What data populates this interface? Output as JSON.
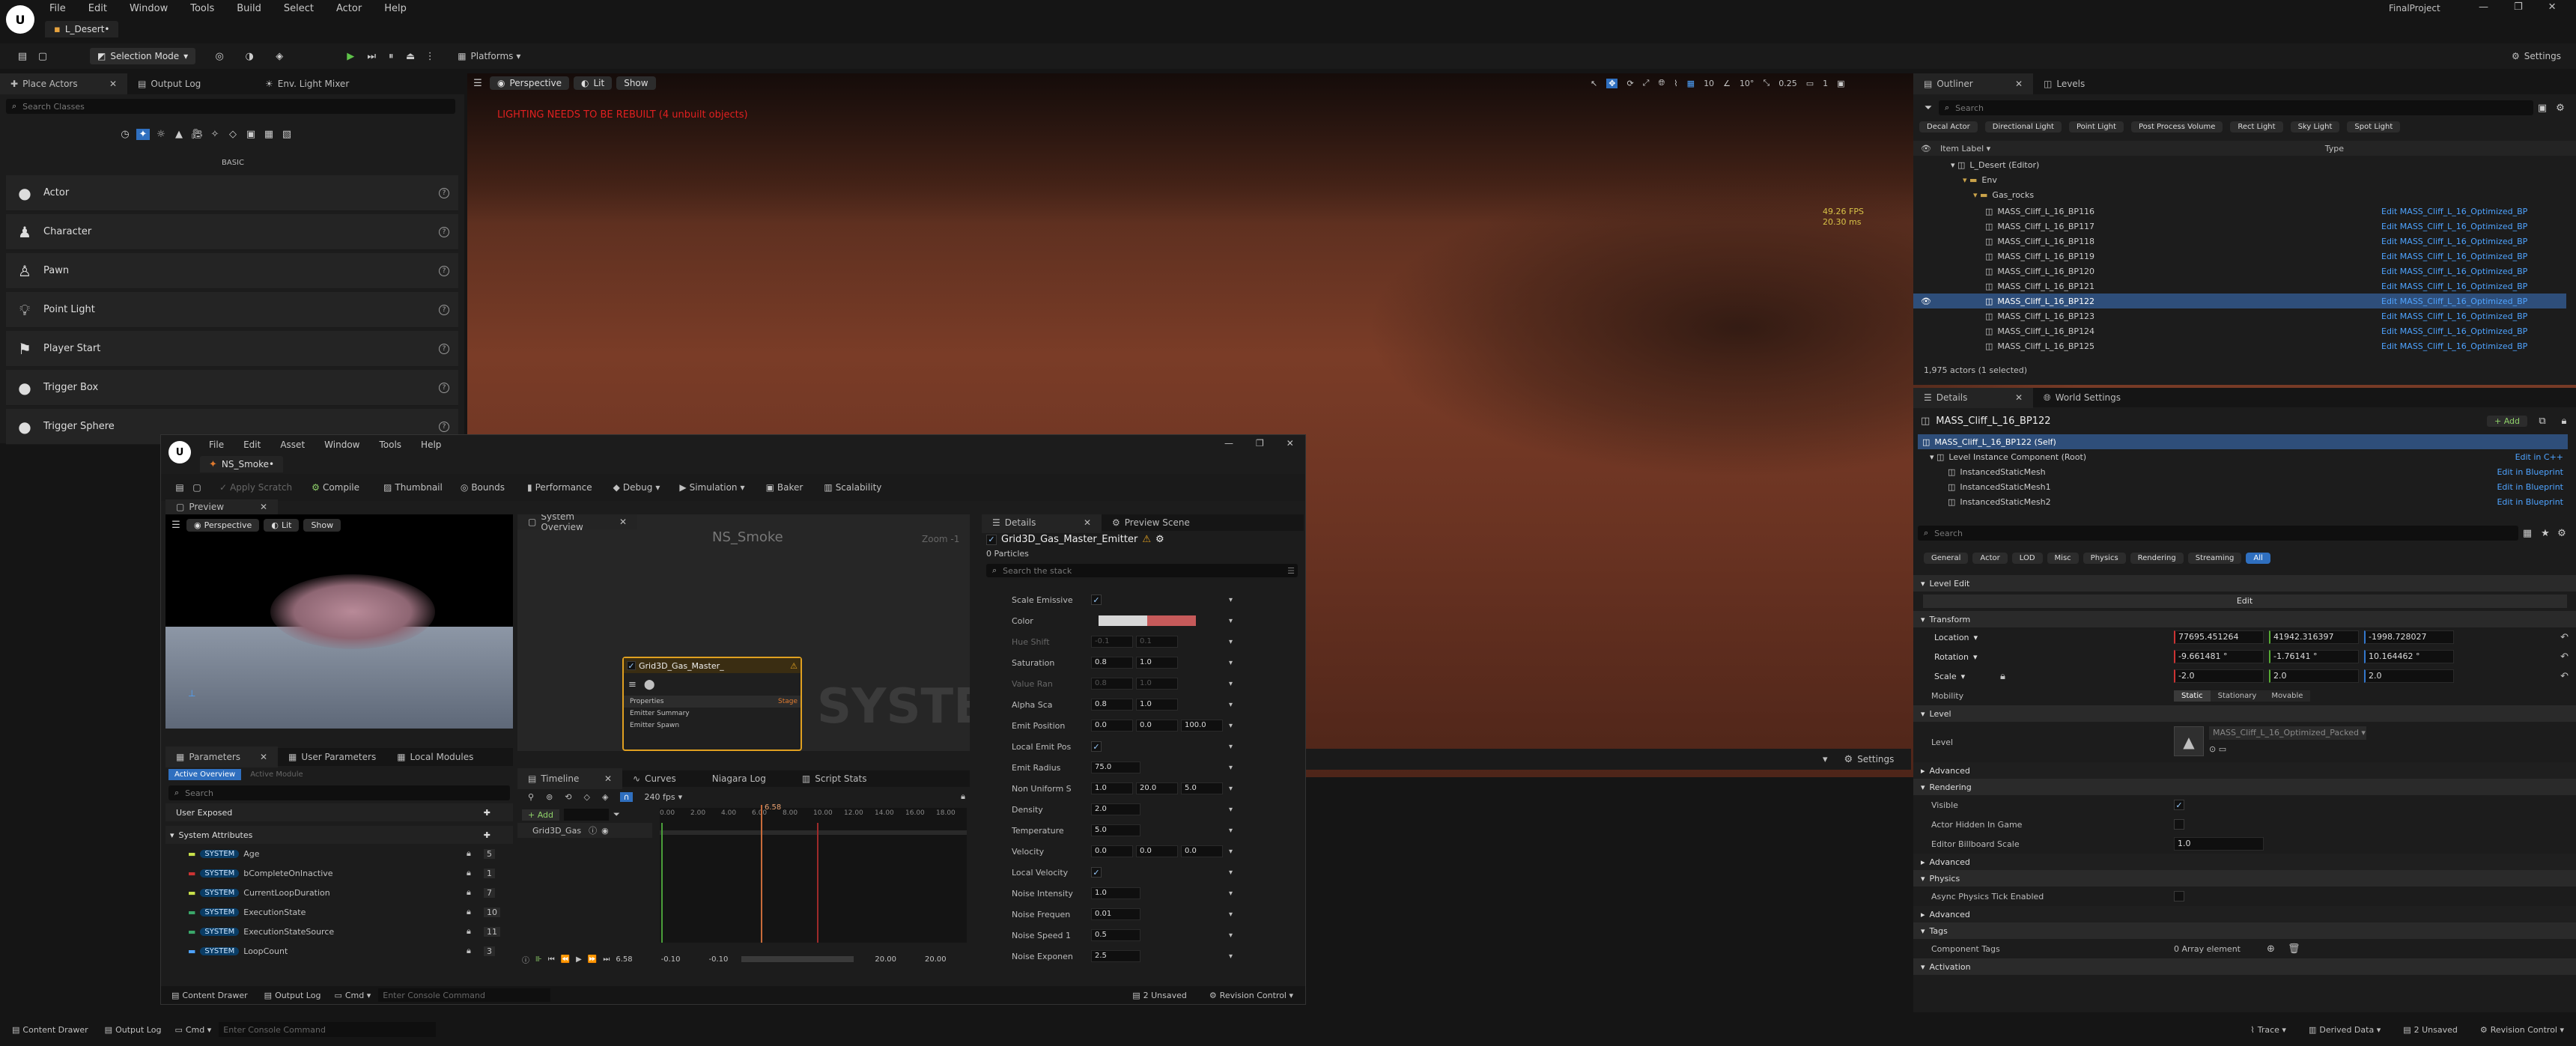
{
  "app": {
    "logo": "U",
    "menu": [
      "File",
      "Edit",
      "Window",
      "Tools",
      "Build",
      "Select",
      "Actor",
      "Help"
    ],
    "level_tab": "L_Desert•",
    "project": "FinalProject",
    "win_controls": [
      "—",
      "❐",
      "✕"
    ]
  },
  "toolbar": {
    "mode": "Selection Mode",
    "platforms": "Platforms",
    "settings": "Settings"
  },
  "left_tabs": [
    "Place Actors",
    "Output Log",
    "Env. Light Mixer"
  ],
  "place": {
    "search_placeholder": "Search Classes",
    "category": "BASIC",
    "items": [
      "Actor",
      "Character",
      "Pawn",
      "Point Light",
      "Player Start",
      "Trigger Box",
      "Trigger Sphere"
    ]
  },
  "viewport": {
    "perspective": "Perspective",
    "lit": "Lit",
    "show": "Show",
    "warning": "LIGHTING NEEDS TO BE REBUILT (4 unbuilt objects)",
    "fps": "49.26 FPS",
    "ms": "20.30 ms",
    "snap_vals": [
      "10",
      "10°",
      "0.25",
      "1"
    ],
    "settings": "Settings"
  },
  "outliner": {
    "tabs": [
      "Outliner",
      "Levels"
    ],
    "search_placeholder": "Search",
    "filters": [
      "Decal Actor",
      "Directional Light",
      "Point Light",
      "Post Process Volume",
      "Rect Light",
      "Sky Light",
      "Spot Light"
    ],
    "col_label": "Item Label ▾",
    "col_type": "Type",
    "tree": [
      "L_Desert (Editor)",
      "Env",
      "Gas_rocks"
    ],
    "rows": [
      "MASS_Cliff_L_16_BP116",
      "MASS_Cliff_L_16_BP117",
      "MASS_Cliff_L_16_BP118",
      "MASS_Cliff_L_16_BP119",
      "MASS_Cliff_L_16_BP120",
      "MASS_Cliff_L_16_BP121",
      "MASS_Cliff_L_16_BP122",
      "MASS_Cliff_L_16_BP123",
      "MASS_Cliff_L_16_BP124",
      "MASS_Cliff_L_16_BP125"
    ],
    "row_type": "Edit MASS_Cliff_L_16_Optimized_BP",
    "status": "1,975 actors (1 selected)"
  },
  "details": {
    "tabs": [
      "Details",
      "World Settings"
    ],
    "actor": "MASS_Cliff_L_16_BP122",
    "add": "+ Add",
    "self": "MASS_Cliff_L_16_BP122 (Self)",
    "root": "Level Instance Component (Root)",
    "root_link": "Edit in C++",
    "comps": [
      "InstancedStaticMesh",
      "InstancedStaticMesh1",
      "InstancedStaticMesh2"
    ],
    "comp_link": "Edit in Blueprint",
    "search_placeholder": "Search",
    "filters": [
      "General",
      "Actor",
      "LOD",
      "Misc",
      "Physics",
      "Rendering",
      "Streaming",
      "All"
    ],
    "sec_level_edit": "Level Edit",
    "edit_btn": "Edit",
    "sec_transform": "Transform",
    "location": "Location",
    "loc": [
      "77695.451264",
      "41942.316397",
      "-1998.728027"
    ],
    "rotation": "Rotation",
    "rot": [
      "-9.661481 °",
      "-1.76141 °",
      "10.164462 °"
    ],
    "scale": "Scale",
    "scl": [
      "-2.0",
      "2.0",
      "2.0"
    ],
    "mobility": "Mobility",
    "mob": [
      "Static",
      "Stationary",
      "Movable"
    ],
    "sec_level": "Level",
    "level_label": "Level",
    "level_val": "MASS_Cliff_L_16_Optimized_Packed ▾",
    "advanced": "Advanced",
    "sec_rendering": "Rendering",
    "visible": "Visible",
    "hidden": "Actor Hidden In Game",
    "billboard": "Editor Billboard Scale",
    "billboard_val": "1.0",
    "sec_physics": "Physics",
    "async": "Async Physics Tick Enabled",
    "sec_tags": "Tags",
    "comp_tags": "Component Tags",
    "tags_val": "0 Array element",
    "activation": "Activation"
  },
  "niagara": {
    "menu": [
      "File",
      "Edit",
      "Asset",
      "Window",
      "Tools",
      "Help"
    ],
    "tab": "NS_Smoke•",
    "toolbar": [
      "Apply Scratch",
      "Compile",
      "Thumbnail",
      "Bounds",
      "Performance",
      "Debug",
      "Simulation",
      "Baker",
      "Scalability"
    ],
    "preview_tab": "Preview",
    "sysov_tab": "System Overview",
    "graph_title": "NS_Smoke",
    "zoom": "Zoom -1",
    "emitter": "Grid3D_Gas_Master_",
    "node_rows": [
      "Properties",
      "Emitter Summary",
      "Emitter Spawn"
    ],
    "stage": "Stage",
    "watermark": "SYSTEM",
    "params_tabs": [
      "Parameters",
      "User Parameters",
      "Local Modules"
    ],
    "sub_tabs": [
      "Active Overview",
      "Active Module"
    ],
    "search_placeholder": "Search",
    "user_exposed": "User Exposed",
    "sys_attr": "System Attributes",
    "badge": "SYSTEM",
    "attrs": [
      {
        "n": "Age",
        "v": "5"
      },
      {
        "n": "bCompleteOnInactive",
        "v": "1"
      },
      {
        "n": "CurrentLoopDuration",
        "v": "7"
      },
      {
        "n": "ExecutionState",
        "v": "10"
      },
      {
        "n": "ExecutionStateSource",
        "v": "11"
      },
      {
        "n": "LoopCount",
        "v": "3"
      }
    ],
    "tl_tabs": [
      "Timeline",
      "Curves",
      "Niagara Log",
      "Script Stats"
    ],
    "add": "+ Add",
    "fps": "240 fps",
    "track": "Grid3D_Gas",
    "ticks": [
      "0.00",
      "2.00",
      "4.00",
      "6.00",
      "8.00",
      "10.00",
      "12.00",
      "14.00",
      "16.00",
      "18.00"
    ],
    "playhead": "6.58",
    "range": [
      "-0.10",
      "-0.10",
      "20.00",
      "20.00"
    ],
    "cur": "6.58",
    "det_tabs": [
      "Details",
      "Preview Scene"
    ],
    "emitter_title": "Grid3D_Gas_Master_Emitter",
    "particles": "0 Particles",
    "stack_search": "Search the stack",
    "props": [
      {
        "n": "Scale Emissive",
        "t": "chk"
      },
      {
        "n": "Color",
        "t": "color"
      },
      {
        "n": "Hue Shift",
        "t": "f2",
        "v": [
          "-0.1",
          "0.1"
        ],
        "dim": true
      },
      {
        "n": "Saturation",
        "t": "f2",
        "v": [
          "0.8",
          "1.0"
        ]
      },
      {
        "n": "Value Ran",
        "t": "f2",
        "v": [
          "0.8",
          "1.0"
        ],
        "dim": true
      },
      {
        "n": "Alpha Sca",
        "t": "f2",
        "v": [
          "0.8",
          "1.0"
        ]
      },
      {
        "n": "Emit Position",
        "t": "f3",
        "v": [
          "0.0",
          "0.0",
          "100.0"
        ]
      },
      {
        "n": "Local Emit Pos",
        "t": "chk"
      },
      {
        "n": "Emit Radius",
        "t": "f1",
        "v": [
          "75.0"
        ]
      },
      {
        "n": "Non Uniform S",
        "t": "f3",
        "v": [
          "1.0",
          "20.0",
          "5.0"
        ]
      },
      {
        "n": "Density",
        "t": "f1",
        "v": [
          "2.0"
        ]
      },
      {
        "n": "Temperature",
        "t": "f1",
        "v": [
          "5.0"
        ]
      },
      {
        "n": "Velocity",
        "t": "f3",
        "v": [
          "0.0",
          "0.0",
          "0.0"
        ]
      },
      {
        "n": "Local Velocity",
        "t": "chk"
      },
      {
        "n": "Noise Intensity",
        "t": "f1",
        "v": [
          "1.0"
        ]
      },
      {
        "n": "Noise Frequen",
        "t": "f1",
        "v": [
          "0.01"
        ]
      },
      {
        "n": "Noise Speed 1",
        "t": "f1",
        "v": [
          "0.5"
        ]
      },
      {
        "n": "Noise Exponen",
        "t": "f1",
        "v": [
          "2.5"
        ]
      }
    ],
    "bottom": [
      "Content Drawer",
      "Output Log",
      "Cmd ▾"
    ],
    "console_placeholder": "Enter Console Command",
    "unsaved": "2 Unsaved",
    "revision": "Revision Control ▾"
  },
  "statusbar": {
    "left": [
      "Content Drawer",
      "Output Log",
      "Cmd ▾"
    ],
    "console_placeholder": "Enter Console Command",
    "right": [
      "Trace ▾",
      "Derived Data ▾",
      "2 Unsaved",
      "Revision Control ▾"
    ]
  }
}
